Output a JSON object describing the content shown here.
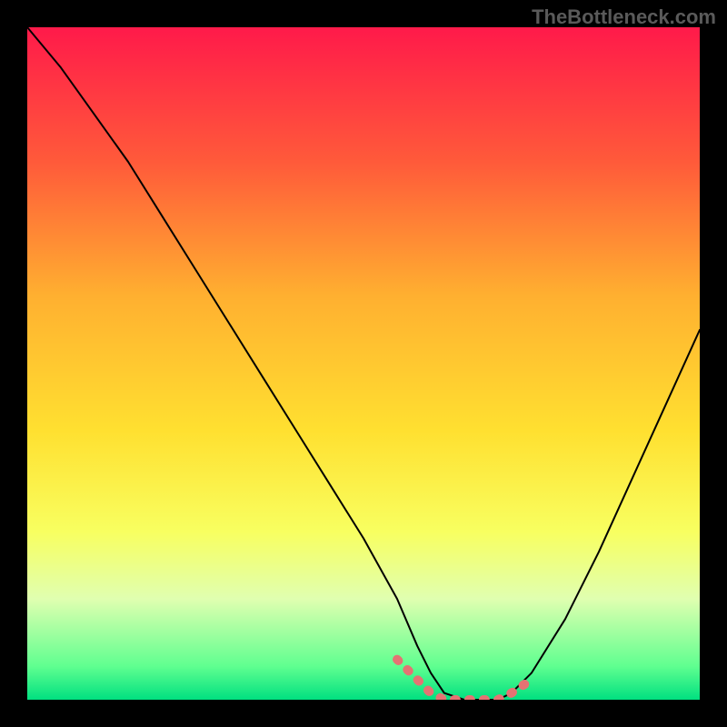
{
  "watermark": "TheBottleneck.com",
  "chart_data": {
    "type": "line",
    "title": "",
    "xlabel": "",
    "ylabel": "",
    "xlim": [
      0,
      100
    ],
    "ylim": [
      0,
      100
    ],
    "gradient_stops": [
      {
        "offset": 0,
        "color": "#ff1a4a"
      },
      {
        "offset": 20,
        "color": "#ff5a3a"
      },
      {
        "offset": 40,
        "color": "#ffb030"
      },
      {
        "offset": 60,
        "color": "#ffe030"
      },
      {
        "offset": 75,
        "color": "#f8ff60"
      },
      {
        "offset": 85,
        "color": "#e0ffb0"
      },
      {
        "offset": 95,
        "color": "#60ff90"
      },
      {
        "offset": 100,
        "color": "#00e080"
      }
    ],
    "series": [
      {
        "name": "curve",
        "color": "#000000",
        "stroke_width": 2,
        "x": [
          0,
          5,
          10,
          15,
          20,
          25,
          30,
          35,
          40,
          45,
          50,
          55,
          58,
          60,
          62,
          65,
          68,
          70,
          72,
          75,
          80,
          85,
          90,
          95,
          100
        ],
        "y": [
          100,
          94,
          87,
          80,
          72,
          64,
          56,
          48,
          40,
          32,
          24,
          15,
          8,
          4,
          1,
          0,
          0,
          0,
          1,
          4,
          12,
          22,
          33,
          44,
          55
        ]
      },
      {
        "name": "highlight-band",
        "color": "#e57373",
        "stroke_width": 10,
        "x": [
          55,
          58,
          60,
          62,
          65,
          68,
          70,
          72,
          75
        ],
        "y": [
          6,
          3,
          1,
          0,
          0,
          0,
          0,
          1,
          3
        ]
      }
    ]
  }
}
